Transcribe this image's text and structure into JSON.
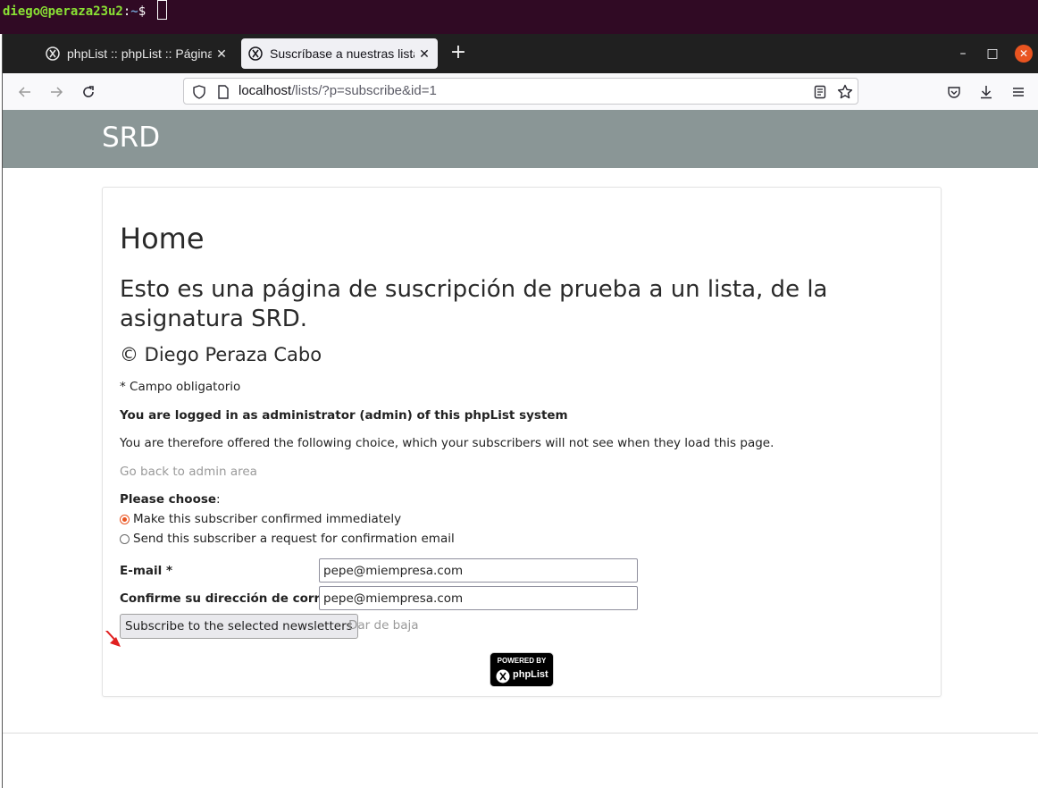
{
  "terminal": {
    "user_host": "diego@peraza23u2",
    "separator": ":",
    "path": "~",
    "prompt": "$"
  },
  "browser": {
    "tabs": [
      {
        "title": "phpList :: phpList :: Página",
        "active": false
      },
      {
        "title": "Suscríbase a nuestras listas",
        "active": true
      }
    ],
    "new_tab": "+",
    "url": {
      "host": "localhost",
      "path": "/lists/?p=subscribe&id=1"
    },
    "window_controls": {
      "minimize": "–",
      "maximize": "□",
      "close": "✕"
    }
  },
  "page": {
    "site_title": "SRD",
    "heading": "Home",
    "description": "Esto es una página de suscripción de prueba a un lista, de la asignatura SRD.",
    "copyright": "© Diego Peraza Cabo",
    "required_note": "* Campo obligatorio",
    "admin_notice": "You are logged in as administrator (admin) of this phpList system",
    "admin_choice_text": "You are therefore offered the following choice, which your subscribers will not see when they load this page.",
    "admin_link": "Go back to admin area",
    "choose_label": "Please choose",
    "choose_colon": ":",
    "options": [
      {
        "label": "Make this subscriber confirmed immediately",
        "checked": true
      },
      {
        "label": "Send this subscriber a request for confirmation email",
        "checked": false
      }
    ],
    "fields": {
      "email_label": "E-mail *",
      "email_value": "pepe@miempresa.com",
      "confirm_label": "Confirme su dirección de correo *",
      "confirm_value": "pepe@miempresa.com"
    },
    "submit_label": "Subscribe to the selected newsletters",
    "unsubscribe_label": "Dar de baja",
    "powered_by": "POWERED BY",
    "powered_name": "phpList"
  },
  "colors": {
    "header_bg": "#8a9696",
    "radio_accent": "#e95420",
    "annotation_arrow": "#e02020"
  },
  "icons": [
    "back-arrow-icon",
    "forward-arrow-icon",
    "reload-icon",
    "shield-icon",
    "page-icon",
    "reader-view-icon",
    "bookmark-star-icon",
    "pocket-icon",
    "download-icon",
    "menu-icon",
    "phplist-favicon-icon"
  ]
}
